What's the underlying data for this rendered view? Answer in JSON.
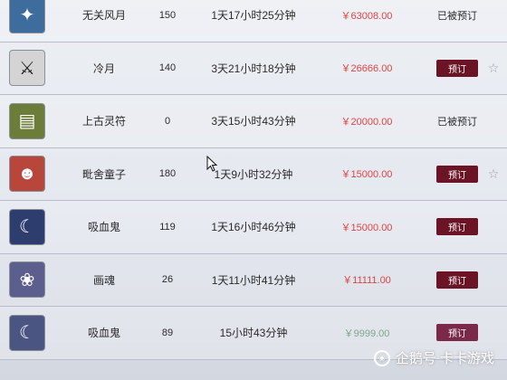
{
  "rows": [
    {
      "icon": "compass-icon",
      "icon_bg": "#3e6c9c",
      "name": "无关风月",
      "level": "150",
      "time": "1天17小时25分钟",
      "price": "￥63008.00",
      "status": "已被预订"
    },
    {
      "icon": "dagger-icon",
      "icon_bg": "#c9c9c9",
      "name": "冷月",
      "level": "140",
      "time": "3天21小时18分钟",
      "price": "￥26666.00",
      "action": "预订"
    },
    {
      "icon": "scroll-icon",
      "icon_bg": "#6c7d3a",
      "name": "上古灵符",
      "level": "0",
      "time": "3天15小时43分钟",
      "price": "￥20000.00",
      "status": "已被预订"
    },
    {
      "icon": "demon-mask-icon",
      "icon_bg": "#b8463a",
      "name": "毗舍童子",
      "level": "180",
      "time": "1天9小时32分钟",
      "price": "￥15000.00",
      "action": "预订"
    },
    {
      "icon": "vampire-icon",
      "icon_bg": "#2d3e6e",
      "name": "吸血鬼",
      "level": "119",
      "time": "1天16小时46分钟",
      "price": "￥15000.00",
      "action": "预订"
    },
    {
      "icon": "ghost-woman-icon",
      "icon_bg": "#5c5f8e",
      "name": "画魂",
      "level": "26",
      "time": "1天11小时41分钟",
      "price": "￥11111.00",
      "action": "预订"
    },
    {
      "icon": "vampire-icon",
      "icon_bg": "#4a5681",
      "name": "吸血鬼",
      "level": "89",
      "time": "15小时43分钟",
      "price": "￥9999.00",
      "action": "预订"
    }
  ],
  "star_glyph": "☆",
  "watermark": {
    "logo_glyph": "◉",
    "text": "企鹅号 卡卡游戏"
  }
}
